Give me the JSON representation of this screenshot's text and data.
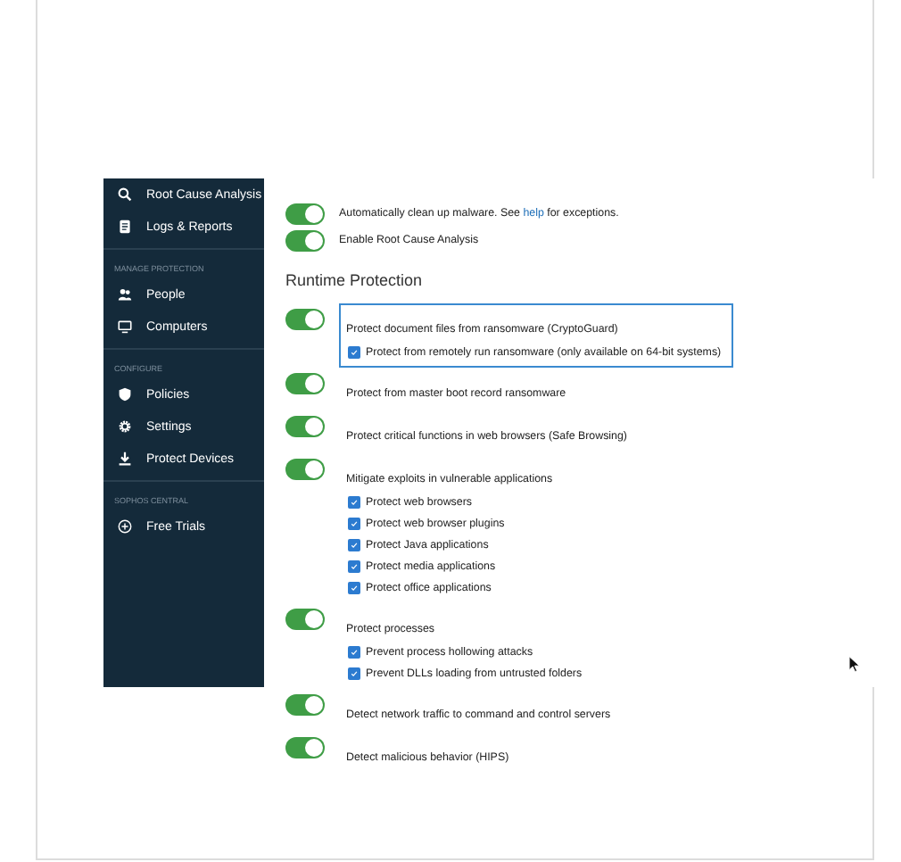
{
  "sidebar": {
    "items": [
      {
        "kind": "item",
        "label": "Root Cause Analysis"
      },
      {
        "kind": "item",
        "label": "Logs & Reports"
      },
      {
        "kind": "section",
        "label": "MANAGE PROTECTION"
      },
      {
        "kind": "item",
        "label": "People"
      },
      {
        "kind": "item",
        "label": "Computers"
      },
      {
        "kind": "section",
        "label": "CONFIGURE"
      },
      {
        "kind": "item",
        "label": "Policies"
      },
      {
        "kind": "item",
        "label": "Settings"
      },
      {
        "kind": "item",
        "label": "Protect Devices"
      },
      {
        "kind": "section",
        "label": "SOPHOS CENTRAL"
      },
      {
        "kind": "item",
        "label": "Free Trials"
      }
    ]
  },
  "top_settings": [
    {
      "on": true,
      "label": "Automatically clean up malware. See ",
      "link": "help",
      "label_after": " for exceptions."
    },
    {
      "on": true,
      "label": "Enable Root Cause Analysis"
    }
  ],
  "section": {
    "title": "Runtime Protection",
    "settings": [
      {
        "on": true,
        "highlighted": true,
        "label": "Protect document files from ransomware (CryptoGuard)",
        "children": [
          {
            "checked": true,
            "label": "Protect from remotely run ransomware (only available on 64-bit systems)"
          }
        ]
      },
      {
        "on": true,
        "highlighted": false,
        "label": "Protect from master boot record ransomware"
      },
      {
        "on": true,
        "highlighted": false,
        "label": "Protect critical functions in web browsers (Safe Browsing)"
      },
      {
        "on": true,
        "highlighted": false,
        "label": "Mitigate exploits in vulnerable applications",
        "children": [
          {
            "checked": true,
            "label": "Protect web browsers"
          },
          {
            "checked": true,
            "label": "Protect web browser plugins"
          },
          {
            "checked": true,
            "label": "Protect Java applications"
          },
          {
            "checked": true,
            "label": "Protect media applications"
          },
          {
            "checked": true,
            "label": "Protect office applications"
          }
        ]
      },
      {
        "on": true,
        "highlighted": false,
        "label": "Protect processes",
        "children": [
          {
            "checked": true,
            "label": "Prevent process hollowing attacks"
          },
          {
            "checked": true,
            "label": "Prevent DLLs loading from untrusted folders"
          }
        ]
      },
      {
        "on": true,
        "highlighted": false,
        "label": "Detect network traffic to command and control servers"
      },
      {
        "on": true,
        "highlighted": false,
        "label": "Detect malicious behavior (HIPS)"
      }
    ]
  }
}
